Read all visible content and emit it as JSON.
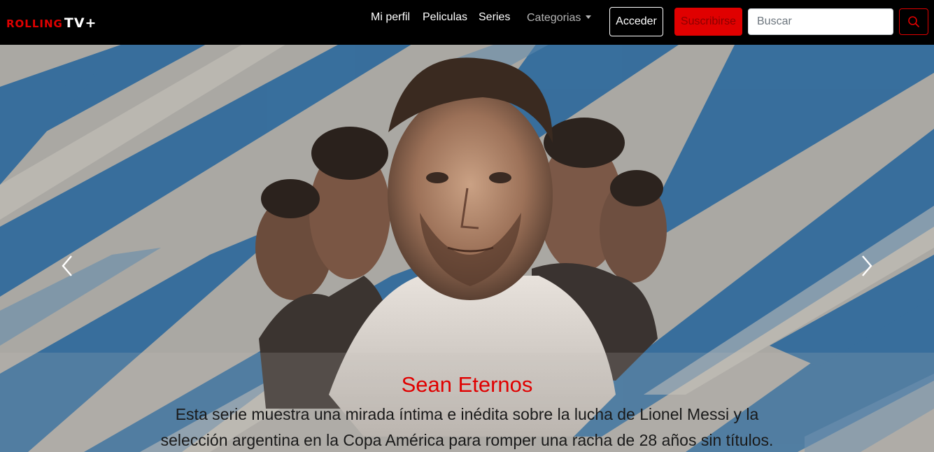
{
  "brand": {
    "name_part1": "ROLLING",
    "name_part2": "TV+"
  },
  "nav": {
    "profile": "Mi perfil",
    "movies": "Peliculas",
    "series": "Series",
    "categories": "Categorias"
  },
  "actions": {
    "login": "Acceder",
    "subscribe": "Suscribirse",
    "search_placeholder": "Buscar",
    "search_button_icon": "search-icon"
  },
  "carousel": {
    "prev_icon": "chevron-left-icon",
    "next_icon": "chevron-right-icon",
    "slide": {
      "title": "Sean Eternos",
      "description": "Esta serie muestra una mirada íntima e inédita sobre la lucha de Lionel Messi y la selección argentina en la Copa América para romper una racha de 28 años sin títulos."
    }
  },
  "colors": {
    "accent": "#e00000",
    "navbar": "#000000",
    "hero_blue": "#2f6a9c",
    "hero_grey": "#b7b3ad"
  }
}
